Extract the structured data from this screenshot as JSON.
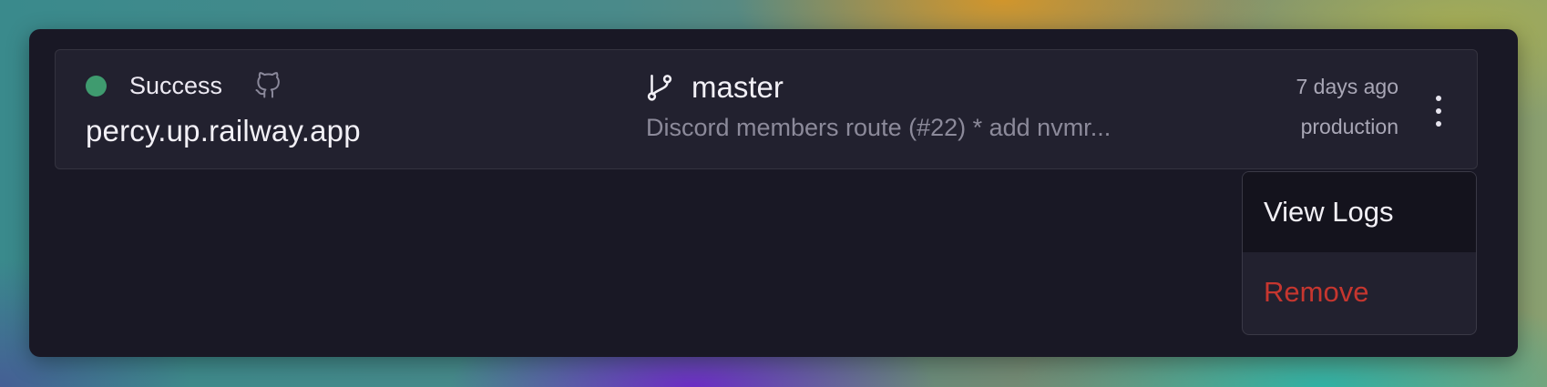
{
  "deployment": {
    "status": "Success",
    "status_color": "#3f9b6f",
    "domain": "percy.up.railway.app",
    "source_icon": "github-icon",
    "branch_icon": "git-branch-icon",
    "branch": "master",
    "commit_message": "Discord members route (#22) * add nvmr...",
    "time_ago": "7 days ago",
    "environment": "production"
  },
  "menu": {
    "trigger_icon": "kebab-menu-icon",
    "items": [
      {
        "label": "View Logs",
        "color": "#f2f0f6"
      },
      {
        "label": "Remove",
        "color": "#c6362f"
      }
    ]
  }
}
